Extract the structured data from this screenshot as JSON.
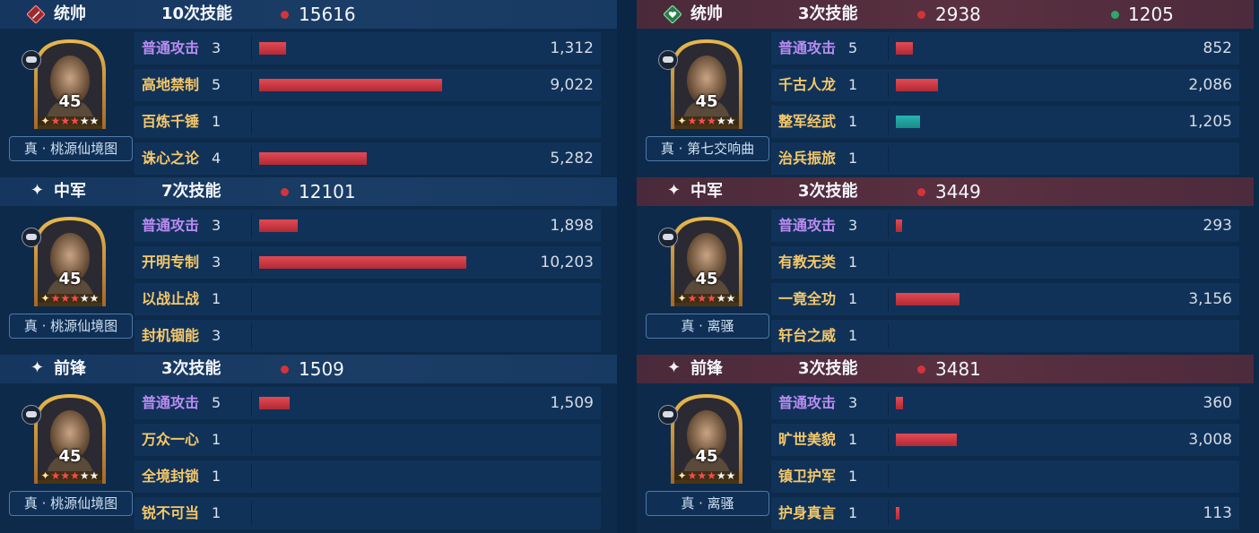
{
  "left": {
    "blocks": [
      {
        "role": "统帅",
        "role_icon": "red-diamond-sword-icon",
        "skills": "10次技能",
        "damage": "15616",
        "level": "45",
        "stars": 5,
        "tag": "真 · 桃源仙境图",
        "rows": [
          {
            "name": "普通攻击",
            "level": "3",
            "value": "1,312",
            "normal": true,
            "fill": 0.129
          },
          {
            "name": "高地禁制",
            "level": "5",
            "value": "9,022",
            "normal": false,
            "fill": 0.884
          },
          {
            "name": "百炼千锤",
            "level": "1",
            "value": "",
            "normal": false,
            "fill": 0
          },
          {
            "name": "诛心之论",
            "level": "4",
            "value": "5,282",
            "normal": false,
            "fill": 0.518
          }
        ]
      },
      {
        "role": "中军",
        "role_icon": "sparkle-icon",
        "skills": "7次技能",
        "damage": "12101",
        "level": "45",
        "stars": 5,
        "tag": "真 · 桃源仙境图",
        "rows": [
          {
            "name": "普通攻击",
            "level": "3",
            "value": "1,898",
            "normal": true,
            "fill": 0.186
          },
          {
            "name": "开明专制",
            "level": "3",
            "value": "10,203",
            "normal": false,
            "fill": 1.0
          },
          {
            "name": "以战止战",
            "level": "1",
            "value": "",
            "normal": false,
            "fill": 0
          },
          {
            "name": "封机锢能",
            "level": "3",
            "value": "",
            "normal": false,
            "fill": 0
          }
        ]
      },
      {
        "role": "前锋",
        "role_icon": "sparkle-icon",
        "skills": "3次技能",
        "damage": "1509",
        "level": "45",
        "stars": 5,
        "tag": "真 · 桃源仙境图",
        "rows": [
          {
            "name": "普通攻击",
            "level": "5",
            "value": "1,509",
            "normal": true,
            "fill": 0.148
          },
          {
            "name": "万众一心",
            "level": "1",
            "value": "",
            "normal": false,
            "fill": 0
          },
          {
            "name": "全境封锁",
            "level": "1",
            "value": "",
            "normal": false,
            "fill": 0
          },
          {
            "name": "锐不可当",
            "level": "1",
            "value": "",
            "normal": false,
            "fill": 0
          }
        ]
      }
    ]
  },
  "right": {
    "blocks": [
      {
        "role": "统帅",
        "role_icon": "green-diamond-heart-icon",
        "skills": "3次技能",
        "damage": "2938",
        "heal": "1205",
        "level": "45",
        "stars": 5,
        "tag": "真 · 第七交响曲",
        "rows": [
          {
            "name": "普通攻击",
            "level": "5",
            "value": "852",
            "normal": true,
            "fill": 0.084,
            "color": "red"
          },
          {
            "name": "千古人龙",
            "level": "1",
            "value": "2,086",
            "normal": false,
            "fill": 0.204,
            "color": "red"
          },
          {
            "name": "整军经武",
            "level": "1",
            "value": "1,205",
            "normal": false,
            "fill": 0.118,
            "color": "teal"
          },
          {
            "name": "治兵振旅",
            "level": "1",
            "value": "",
            "normal": false,
            "fill": 0
          }
        ]
      },
      {
        "role": "中军",
        "role_icon": "sparkle-icon",
        "skills": "3次技能",
        "damage": "3449",
        "level": "45",
        "stars": 5,
        "tag": "真 · 离骚",
        "rows": [
          {
            "name": "普通攻击",
            "level": "3",
            "value": "293",
            "normal": true,
            "fill": 0.029,
            "color": "red"
          },
          {
            "name": "有教无类",
            "level": "1",
            "value": "",
            "normal": false,
            "fill": 0
          },
          {
            "name": "一竟全功",
            "level": "1",
            "value": "3,156",
            "normal": false,
            "fill": 0.309,
            "color": "red"
          },
          {
            "name": "轩台之威",
            "level": "1",
            "value": "",
            "normal": false,
            "fill": 0
          }
        ]
      },
      {
        "role": "前锋",
        "role_icon": "sparkle-icon",
        "skills": "3次技能",
        "damage": "3481",
        "level": "45",
        "stars": 5,
        "tag": "真 · 离骚",
        "rows": [
          {
            "name": "普通攻击",
            "level": "3",
            "value": "360",
            "normal": true,
            "fill": 0.035,
            "color": "red"
          },
          {
            "name": "旷世美貌",
            "level": "1",
            "value": "3,008",
            "normal": false,
            "fill": 0.295,
            "color": "red"
          },
          {
            "name": "镇卫护军",
            "level": "1",
            "value": "",
            "normal": false,
            "fill": 0
          },
          {
            "name": "护身真言",
            "level": "1",
            "value": "113",
            "normal": false,
            "fill": 0.011,
            "color": "red"
          }
        ]
      }
    ]
  },
  "colors": {
    "damage_dot": "#d3343b",
    "heal_dot": "#2fa86a",
    "normal_attack": "#b98cf2",
    "skill_name": "#f5c86a",
    "bar_red": "#d23c46",
    "bar_teal": "#22a2a0"
  }
}
